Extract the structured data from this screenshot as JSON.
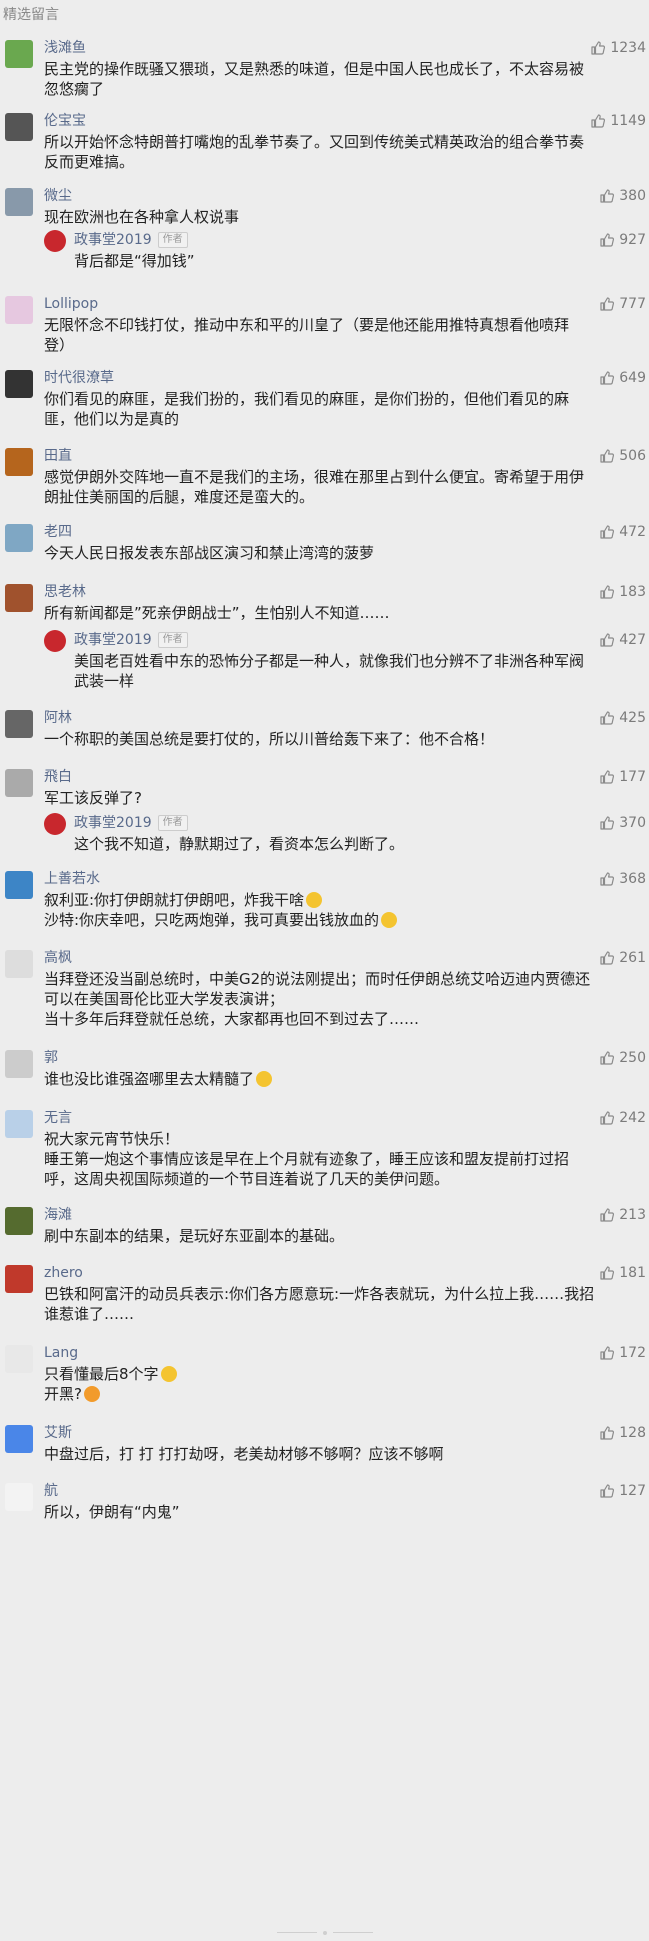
{
  "section_title": "精选留言",
  "comments": [
    {
      "name": "浅滩鱼",
      "likes": "1234",
      "lines": [
        "民主党的操作既骚又猥琐，又是熟悉的味道，但是中国人民也成长了，不太容易被",
        "忽悠瘸了"
      ]
    },
    {
      "name": "伦宝宝",
      "likes": "1149",
      "lines": [
        "所以开始怀念特朗普打嘴炮的乱拳节奏了。又回到传统美式精英政治的组合拳节奏",
        "反而更难搞。"
      ]
    },
    {
      "name": "微尘",
      "likes": "380",
      "lines": [
        "现在欧洲也在各种拿人权说事"
      ],
      "reply": {
        "name": "政事堂2019",
        "tag": "作者",
        "likes": "927",
        "lines": [
          "背后都是“得加钱”"
        ]
      }
    },
    {
      "name": "Lollipop",
      "likes": "777",
      "lines": [
        "无限怀念不印钱打仗，推动中东和平的川皇了（要是他还能用推特真想看他喷拜",
        "登）"
      ]
    },
    {
      "name": "时代很潦草",
      "likes": "649",
      "lines": [
        "你们看见的麻匪，是我们扮的，我们看见的麻匪，是你们扮的，但他们看见的麻",
        "匪，他们以为是真的"
      ]
    },
    {
      "name": "田直",
      "likes": "506",
      "lines": [
        "感觉伊朗外交阵地一直不是我们的主场，很难在那里占到什么便宜。寄希望于用伊",
        "朗扯住美丽国的后腿，难度还是蛮大的。"
      ]
    },
    {
      "name": "老四",
      "likes": "472",
      "lines": [
        "今天人民日报发表东部战区演习和禁止湾湾的菠萝"
      ]
    },
    {
      "name": "思老林",
      "likes": "183",
      "lines": [
        "所有新闻都是”死亲伊朗战士”，生怕别人不知道……"
      ],
      "reply": {
        "name": "政事堂2019",
        "tag": "作者",
        "likes": "427",
        "lines": [
          "美国老百姓看中东的恐怖分子都是一种人，就像我们也分辨不了非洲各种军阀",
          "武装一样"
        ]
      }
    },
    {
      "name": "阿林",
      "likes": "425",
      "lines": [
        "一个称职的美国总统是要打仗的，所以川普给轰下来了：他不合格！"
      ]
    },
    {
      "name": "飛白",
      "likes": "177",
      "lines": [
        "军工该反弹了?"
      ],
      "reply": {
        "name": "政事堂2019",
        "tag": "作者",
        "likes": "370",
        "lines": [
          "这个我不知道，静默期过了，看资本怎么判断了。"
        ]
      }
    },
    {
      "name": "上善若水",
      "likes": "368",
      "lines": [
        "叙利亚:你打伊朗就打伊朗吧，炸我干啥",
        "沙特:你庆幸吧，只吃两炮弹，我可真要出钱放血的"
      ]
    },
    {
      "name": "高枫",
      "likes": "261",
      "lines": [
        "当拜登还没当副总统时，中美G2的说法刚提出；而时任伊朗总统艾哈迈迪内贾德还",
        "可以在美国哥伦比亚大学发表演讲；",
        "当十多年后拜登就任总统，大家都再也回不到过去了……"
      ]
    },
    {
      "name": "郭",
      "likes": "250",
      "lines": [
        "谁也没比谁强盗哪里去太精髓了"
      ]
    },
    {
      "name": "无言",
      "likes": "242",
      "lines": [
        "祝大家元宵节快乐！",
        "睡王第一炮这个事情应该是早在上个月就有迹象了，睡王应该和盟友提前打过招",
        "呼，这周央视国际频道的一个节目连着说了几天的美伊问题。"
      ]
    },
    {
      "name": "海滩",
      "likes": "213",
      "lines": [
        "刷中东副本的结果，是玩好东亚副本的基础。"
      ]
    },
    {
      "name": "zhero",
      "likes": "181",
      "lines": [
        "巴铁和阿富汗的动员兵表示:你们各方愿意玩:一炸各表就玩，为什么拉上我……我招",
        "谁惹谁了……"
      ]
    },
    {
      "name": "Lang",
      "likes": "172",
      "lines": [
        "只看懂最后8个字",
        "开黑?"
      ]
    },
    {
      "name": "艾斯",
      "likes": "128",
      "lines": [
        "中盘过后，打 打 打打劫呀，老美劫材够不够啊？应该不够啊"
      ]
    },
    {
      "name": "航",
      "likes": "127",
      "lines": [
        "所以，伊朗有“内鬼”"
      ]
    }
  ],
  "colors": {
    "name": "#596a8b",
    "text": "#222222",
    "muted": "#888888",
    "background": "#ededed"
  },
  "icons": {
    "like": "thumbs-up-icon"
  }
}
